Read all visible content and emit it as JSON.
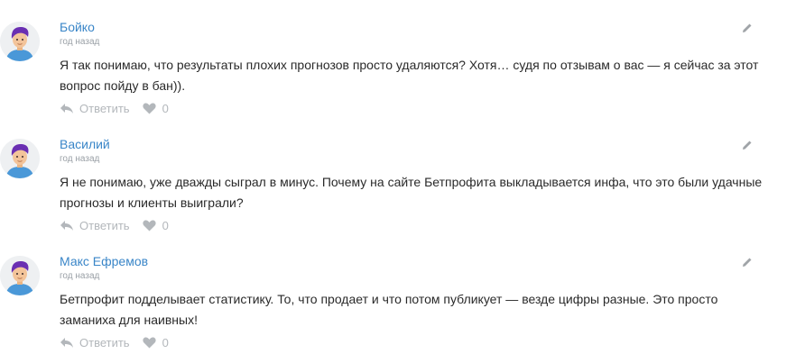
{
  "comments": [
    {
      "author": "Бойко",
      "time": "год назад",
      "text": "Я так понимаю, что результаты плохих прогнозов просто удаляются? Хотя… судя по отзывам о вас — я сейчас за этот вопрос пойду в бан)).",
      "reply_label": "Ответить",
      "likes": "0"
    },
    {
      "author": "Василий",
      "time": "год назад",
      "text": "Я не понимаю, уже дважды сыграл в минус. Почему на сайте Бетпрофита выкладывается инфа, что это были удачные прогнозы и клиенты выиграли?",
      "reply_label": "Ответить",
      "likes": "0"
    },
    {
      "author": "Макс Ефремов",
      "time": "год назад",
      "text": "Бетпрофит подделывает статистику. То, что продает и что потом публикует — везде цифры разные. Это просто заманиха для наивных!",
      "reply_label": "Ответить",
      "likes": "0"
    }
  ],
  "colors": {
    "author": "#3a86c8",
    "muted": "#b3b7bb",
    "avatar_hair": "#6a2fb2",
    "avatar_skin": "#f3c49a",
    "avatar_shirt": "#4a98d8"
  },
  "icons": [
    "edit-pencil-icon",
    "reply-arrow-icon",
    "heart-icon",
    "avatar"
  ]
}
